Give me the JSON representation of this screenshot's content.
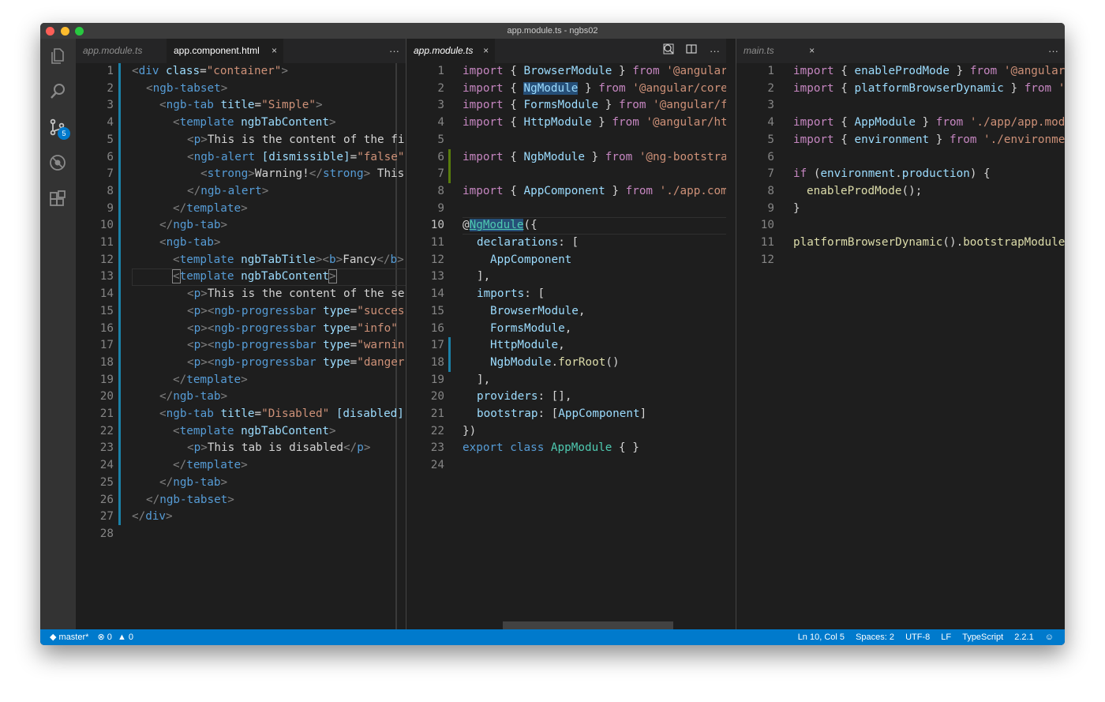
{
  "window": {
    "title": "app.module.ts - ngbs02"
  },
  "activity_bar": {
    "scm_badge": "5"
  },
  "pane1": {
    "tabs": [
      {
        "label": "app.module.ts"
      },
      {
        "label": "app.component.html",
        "close": "×"
      }
    ],
    "more": "···",
    "lines": [
      {
        "n": "1"
      },
      {
        "n": "2"
      },
      {
        "n": "3"
      },
      {
        "n": "4"
      },
      {
        "n": "5"
      },
      {
        "n": "6"
      },
      {
        "n": "7"
      },
      {
        "n": "8"
      },
      {
        "n": "9"
      },
      {
        "n": "10"
      },
      {
        "n": "11"
      },
      {
        "n": "12"
      },
      {
        "n": "13"
      },
      {
        "n": "14"
      },
      {
        "n": "15"
      },
      {
        "n": "16"
      },
      {
        "n": "17"
      },
      {
        "n": "18"
      },
      {
        "n": "19"
      },
      {
        "n": "20"
      },
      {
        "n": "21"
      },
      {
        "n": "22"
      },
      {
        "n": "23"
      },
      {
        "n": "24"
      },
      {
        "n": "25"
      },
      {
        "n": "26"
      },
      {
        "n": "27"
      },
      {
        "n": "28"
      }
    ],
    "code": {
      "l1": {
        "t1": "<",
        "t2": "div",
        "t3": " class",
        "t4": "=",
        "t5": "\"container\"",
        "t6": ">"
      },
      "l2": {
        "t1": "<",
        "t2": "ngb-tabset",
        "t3": ">"
      },
      "l3": {
        "t1": "<",
        "t2": "ngb-tab",
        "t3": " title",
        "t4": "=",
        "t5": "\"Simple\"",
        "t6": ">"
      },
      "l4": {
        "t1": "<",
        "t2": "template",
        "t3": " ngbTabContent",
        "t4": ">"
      },
      "l5": {
        "t1": "<",
        "t2": "p",
        "t3": ">",
        "t4": "This is the content of the fi"
      },
      "l6": {
        "t1": "<",
        "t2": "ngb-alert",
        "t3": " [dismissible]",
        "t4": "=",
        "t5": "\"false\""
      },
      "l7": {
        "t1": "<",
        "t2": "strong",
        "t3": ">",
        "t4": "Warning!",
        "t5": "</",
        "t6": "strong",
        "t7": ">",
        "t8": " This"
      },
      "l8": {
        "t1": "</",
        "t2": "ngb-alert",
        "t3": ">"
      },
      "l9": {
        "t1": "</",
        "t2": "template",
        "t3": ">"
      },
      "l10": {
        "t1": "</",
        "t2": "ngb-tab",
        "t3": ">"
      },
      "l11": {
        "t1": "<",
        "t2": "ngb-tab",
        "t3": ">"
      },
      "l12": {
        "t1": "<",
        "t2": "template",
        "t3": " ngbTabTitle",
        "t4": "><",
        "t5": "b",
        "t6": ">",
        "t7": "Fancy",
        "t8": "</",
        "t9": "b",
        "t10": ">"
      },
      "l13": {
        "t1": "<",
        "t2": "template",
        "t3": " ngbTabContent",
        "t4": ">"
      },
      "l14": {
        "t1": "<",
        "t2": "p",
        "t3": ">",
        "t4": "This is the content of the se"
      },
      "l15": {
        "t1": "<",
        "t2": "p",
        "t3": "><",
        "t4": "ngb-progressbar",
        "t5": " type",
        "t6": "=",
        "t7": "\"succes"
      },
      "l16": {
        "t1": "<",
        "t2": "p",
        "t3": "><",
        "t4": "ngb-progressbar",
        "t5": " type",
        "t6": "=",
        "t7": "\"info\""
      },
      "l17": {
        "t1": "<",
        "t2": "p",
        "t3": "><",
        "t4": "ngb-progressbar",
        "t5": " type",
        "t6": "=",
        "t7": "\"warnin"
      },
      "l18": {
        "t1": "<",
        "t2": "p",
        "t3": "><",
        "t4": "ngb-progressbar",
        "t5": " type",
        "t6": "=",
        "t7": "\"danger"
      },
      "l19": {
        "t1": "</",
        "t2": "template",
        "t3": ">"
      },
      "l20": {
        "t1": "</",
        "t2": "ngb-tab",
        "t3": ">"
      },
      "l21": {
        "t1": "<",
        "t2": "ngb-tab",
        "t3": " title",
        "t4": "=",
        "t5": "\"Disabled\"",
        "t6": " [disabled]"
      },
      "l22": {
        "t1": "<",
        "t2": "template",
        "t3": " ngbTabContent",
        "t4": ">"
      },
      "l23": {
        "t1": "<",
        "t2": "p",
        "t3": ">",
        "t4": "This tab is disabled",
        "t5": "</",
        "t6": "p",
        "t7": ">"
      },
      "l24": {
        "t1": "</",
        "t2": "template",
        "t3": ">"
      },
      "l25": {
        "t1": "</",
        "t2": "ngb-tab",
        "t3": ">"
      },
      "l26": {
        "t1": "</",
        "t2": "ngb-tabset",
        "t3": ">"
      },
      "l27": {
        "t1": "</",
        "t2": "div",
        "t3": ">"
      }
    }
  },
  "pane2": {
    "tabs": [
      {
        "label": "app.module.ts",
        "close": "×"
      }
    ],
    "more": "···",
    "lines": [
      {
        "n": "1"
      },
      {
        "n": "2"
      },
      {
        "n": "3"
      },
      {
        "n": "4"
      },
      {
        "n": "5"
      },
      {
        "n": "6"
      },
      {
        "n": "7"
      },
      {
        "n": "8"
      },
      {
        "n": "9"
      },
      {
        "n": "10"
      },
      {
        "n": "11"
      },
      {
        "n": "12"
      },
      {
        "n": "13"
      },
      {
        "n": "14"
      },
      {
        "n": "15"
      },
      {
        "n": "16"
      },
      {
        "n": "17"
      },
      {
        "n": "18"
      },
      {
        "n": "19"
      },
      {
        "n": "20"
      },
      {
        "n": "21"
      },
      {
        "n": "22"
      },
      {
        "n": "23"
      },
      {
        "n": "24"
      }
    ],
    "code": {
      "l1": {
        "a": "import",
        "b": " { ",
        "c": "BrowserModule",
        "d": " } ",
        "e": "from",
        "f": " '@angular/"
      },
      "l2": {
        "a": "import",
        "b": " { ",
        "c": "NgModule",
        "d": " } ",
        "e": "from",
        "f": " '@angular/core'"
      },
      "l3": {
        "a": "import",
        "b": " { ",
        "c": "FormsModule",
        "d": " } ",
        "e": "from",
        "f": " '@angular/fo"
      },
      "l4": {
        "a": "import",
        "b": " { ",
        "c": "HttpModule",
        "d": " } ",
        "e": "from",
        "f": " '@angular/htt"
      },
      "l6": {
        "a": "import",
        "b": " { ",
        "c": "NgbModule",
        "d": " } ",
        "e": "from",
        "f": " '@ng-bootstrap"
      },
      "l8": {
        "a": "import",
        "b": " { ",
        "c": "AppComponent",
        "d": " } ",
        "e": "from",
        "f": " './app.comp"
      },
      "l10": {
        "a": "@",
        "b": "NgModule",
        "c": "({"
      },
      "l11": {
        "a": "declarations",
        "b": ": ["
      },
      "l12": {
        "a": "AppComponent"
      },
      "l13": {
        "a": "],"
      },
      "l14": {
        "a": "imports",
        "b": ": ["
      },
      "l15": {
        "a": "BrowserModule",
        "b": ","
      },
      "l16": {
        "a": "FormsModule",
        "b": ","
      },
      "l17": {
        "a": "HttpModule",
        "b": ","
      },
      "l18": {
        "a": "NgbModule",
        "b": ".",
        "c": "forRoot",
        "d": "()"
      },
      "l19": {
        "a": "],"
      },
      "l20": {
        "a": "providers",
        "b": ": [],"
      },
      "l21": {
        "a": "bootstrap",
        "b": ": [",
        "c": "AppComponent",
        "d": "]"
      },
      "l22": {
        "a": "})"
      },
      "l23": {
        "a": "export",
        "b": " class ",
        "c": "AppModule",
        "d": " { }"
      }
    }
  },
  "pane3": {
    "tabs": [
      {
        "label": "main.ts",
        "close": "×"
      }
    ],
    "more": "···",
    "lines": [
      {
        "n": "1"
      },
      {
        "n": "2"
      },
      {
        "n": "3"
      },
      {
        "n": "4"
      },
      {
        "n": "5"
      },
      {
        "n": "6"
      },
      {
        "n": "7"
      },
      {
        "n": "8"
      },
      {
        "n": "9"
      },
      {
        "n": "10"
      },
      {
        "n": "11"
      },
      {
        "n": "12"
      }
    ],
    "code": {
      "l1": {
        "a": "import",
        "b": " { ",
        "c": "enableProdMode",
        "d": " } ",
        "e": "from",
        "f": " '@angular"
      },
      "l2": {
        "a": "import",
        "b": " { ",
        "c": "platformBrowserDynamic",
        "d": " } ",
        "e": "from",
        "f": " '"
      },
      "l4": {
        "a": "import",
        "b": " { ",
        "c": "AppModule",
        "d": " } ",
        "e": "from",
        "f": " './app/app.mod"
      },
      "l5": {
        "a": "import",
        "b": " { ",
        "c": "environment",
        "d": " } ",
        "e": "from",
        "f": " './environme"
      },
      "l7": {
        "a": "if",
        "b": " (",
        "c": "environment",
        "d": ".",
        "e": "production",
        "f": ") {"
      },
      "l8": {
        "a": "enableProdMode",
        "b": "();"
      },
      "l9": {
        "a": "}"
      },
      "l11": {
        "a": "platformBrowserDynamic",
        "b": "().",
        "c": "bootstrapModule"
      }
    }
  },
  "status": {
    "branch": "master*",
    "errors": "0",
    "warnings": "0",
    "position": "Ln 10, Col 5",
    "spaces": "Spaces: 2",
    "encoding": "UTF-8",
    "eol": "LF",
    "language": "TypeScript",
    "version": "2.2.1"
  }
}
